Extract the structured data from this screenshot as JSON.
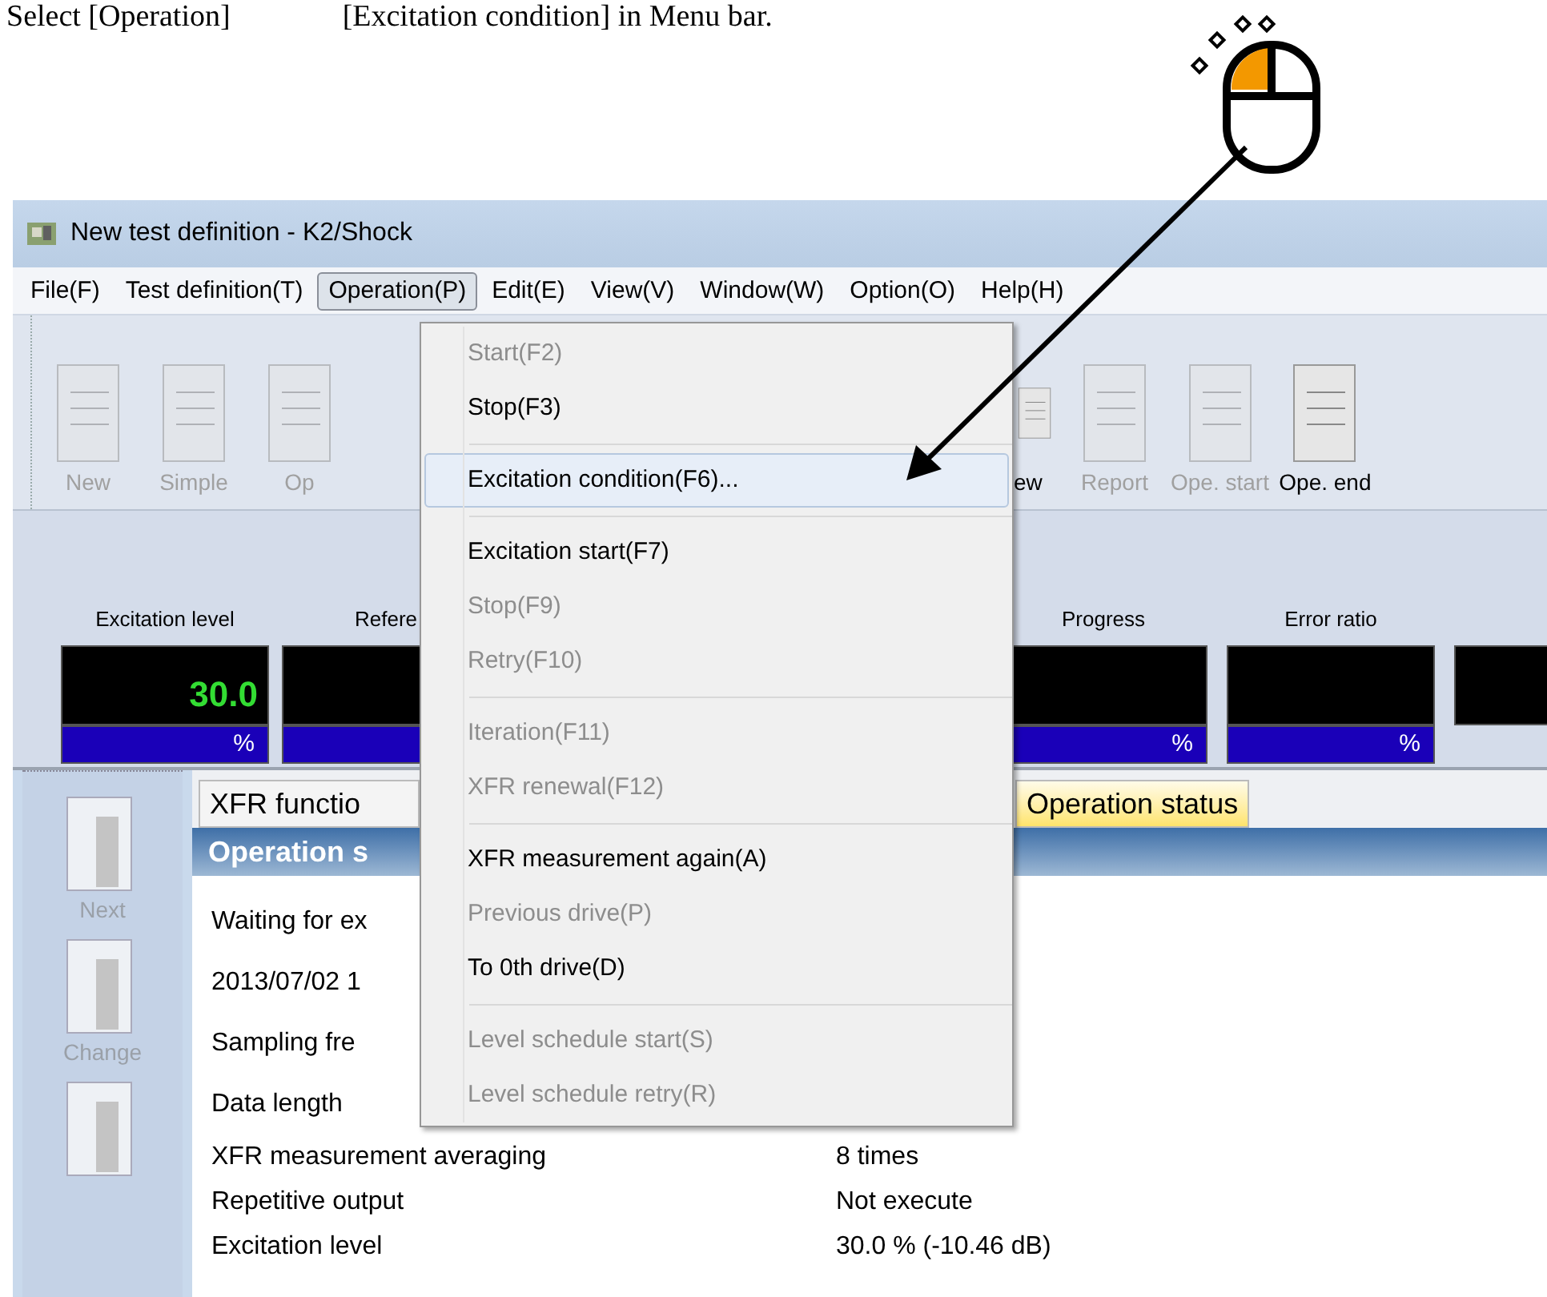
{
  "caption": {
    "parts": [
      "Select [Operation]",
      "[Excitation condition] in Menu bar."
    ]
  },
  "window": {
    "title": "New test definition - K2/Shock"
  },
  "menu_bar": [
    {
      "label": "File(F)",
      "selected": false
    },
    {
      "label": "Test definition(T)",
      "selected": false
    },
    {
      "label": "Operation(P)",
      "selected": true
    },
    {
      "label": "Edit(E)",
      "selected": false
    },
    {
      "label": "View(V)",
      "selected": false
    },
    {
      "label": "Window(W)",
      "selected": false
    },
    {
      "label": "Option(O)",
      "selected": false
    },
    {
      "label": "Help(H)",
      "selected": false
    }
  ],
  "toolbar_left": [
    {
      "label": "New",
      "disabled": true
    },
    {
      "label": "Simple",
      "disabled": true
    },
    {
      "label": "Op",
      "disabled": true
    }
  ],
  "toolbar_right": [
    {
      "label": "ew",
      "disabled": false
    },
    {
      "label": "Report",
      "disabled": true
    },
    {
      "label": "Ope. start",
      "disabled": true
    },
    {
      "label": "Ope. end",
      "disabled": false
    }
  ],
  "meters_left": [
    {
      "kind": "full",
      "label": "Excitation level",
      "value": "30.0",
      "unit": "%"
    },
    {
      "kind": "full",
      "label": "Refere"
    }
  ],
  "meters_right": [
    {
      "kind": "full",
      "label": "Progress",
      "unit": "%"
    },
    {
      "kind": "full",
      "label": "Error ratio",
      "unit": "%"
    },
    {
      "kind": "partial"
    }
  ],
  "side_buttons": [
    {
      "kind": "full",
      "label": "Next"
    },
    {
      "kind": "full",
      "label": "Change"
    },
    {
      "kind": "partial"
    }
  ],
  "tabs": [
    {
      "label": "XFR functio",
      "selected": false
    },
    {
      "label": "Operation status",
      "selected": true
    }
  ],
  "panel": {
    "header": "Operation s",
    "rows": [
      {
        "label": "Waiting for ex"
      },
      {
        "label": "2013/07/02 1"
      },
      {
        "label": "Sampling fre"
      },
      {
        "label": "Data length"
      },
      {
        "label": "XFR measurement averaging",
        "value": "8 times"
      },
      {
        "label": "Repetitive output",
        "value": "Not execute"
      },
      {
        "label": "Excitation level",
        "value": "30.0 % (-10.46 dB)"
      }
    ]
  },
  "dropdown": [
    {
      "kind": "item",
      "label": "Start(F2)",
      "disabled": true,
      "selected": false
    },
    {
      "kind": "item",
      "label": "Stop(F3)",
      "disabled": false,
      "selected": false
    },
    {
      "kind": "separator"
    },
    {
      "kind": "item",
      "label": "Excitation condition(F6)...",
      "disabled": false,
      "selected": true
    },
    {
      "kind": "separator"
    },
    {
      "kind": "item",
      "label": "Excitation start(F7)",
      "disabled": false,
      "selected": false
    },
    {
      "kind": "item",
      "label": "Stop(F9)",
      "disabled": true,
      "selected": false
    },
    {
      "kind": "item",
      "label": "Retry(F10)",
      "disabled": true,
      "selected": false
    },
    {
      "kind": "separator"
    },
    {
      "kind": "item",
      "label": "Iteration(F11)",
      "disabled": true,
      "selected": false
    },
    {
      "kind": "item",
      "label": "XFR renewal(F12)",
      "disabled": true,
      "selected": false
    },
    {
      "kind": "separator"
    },
    {
      "kind": "item",
      "label": "XFR measurement again(A)",
      "disabled": false,
      "selected": false
    },
    {
      "kind": "item",
      "label": "Previous drive(P)",
      "disabled": true,
      "selected": false
    },
    {
      "kind": "item",
      "label": "To 0th drive(D)",
      "disabled": false,
      "selected": false
    },
    {
      "kind": "separator"
    },
    {
      "kind": "item",
      "label": "Level schedule start(S)",
      "disabled": true,
      "selected": false
    },
    {
      "kind": "item",
      "label": "Level schedule retry(R)",
      "disabled": true,
      "selected": false
    }
  ]
}
